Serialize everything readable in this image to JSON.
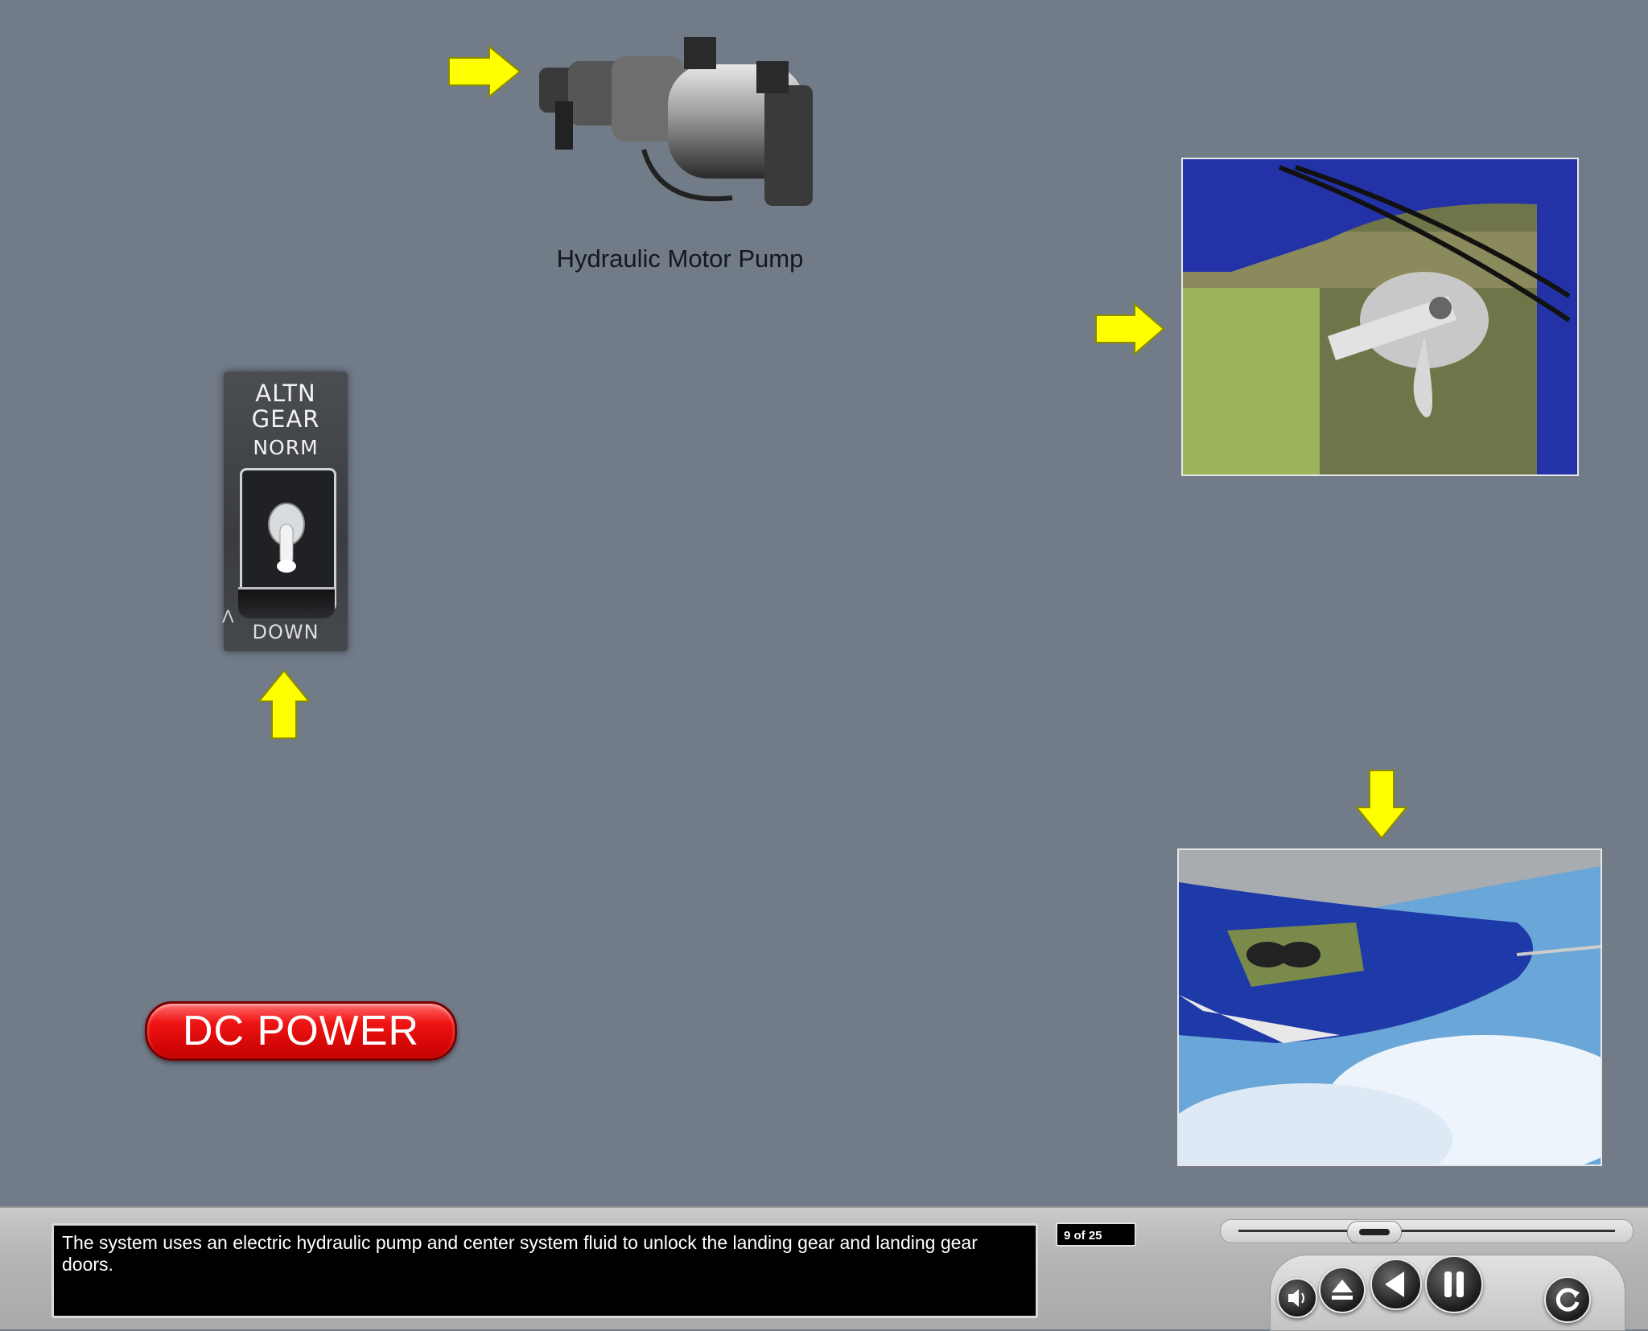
{
  "pump": {
    "label": "Hydraulic Motor Pump"
  },
  "switch_panel": {
    "line1": "ALTN",
    "line2": "GEAR",
    "norm_label": "NORM",
    "down_label": "DOWN",
    "mark": "Λ"
  },
  "dc_power_button": {
    "label": "DC POWER"
  },
  "caption": {
    "text": "The system uses an electric hydraulic pump and center system fluid to unlock the landing gear and landing gear doors."
  },
  "navigation": {
    "page_counter": "9 of 25",
    "progress": 0.36
  },
  "controls": [
    "volume-icon",
    "eject-icon",
    "back-icon",
    "pause-icon",
    "replay-icon"
  ],
  "colors": {
    "background": "#727b88",
    "arrow": "#ffff00",
    "dc_button": "#e81010"
  }
}
